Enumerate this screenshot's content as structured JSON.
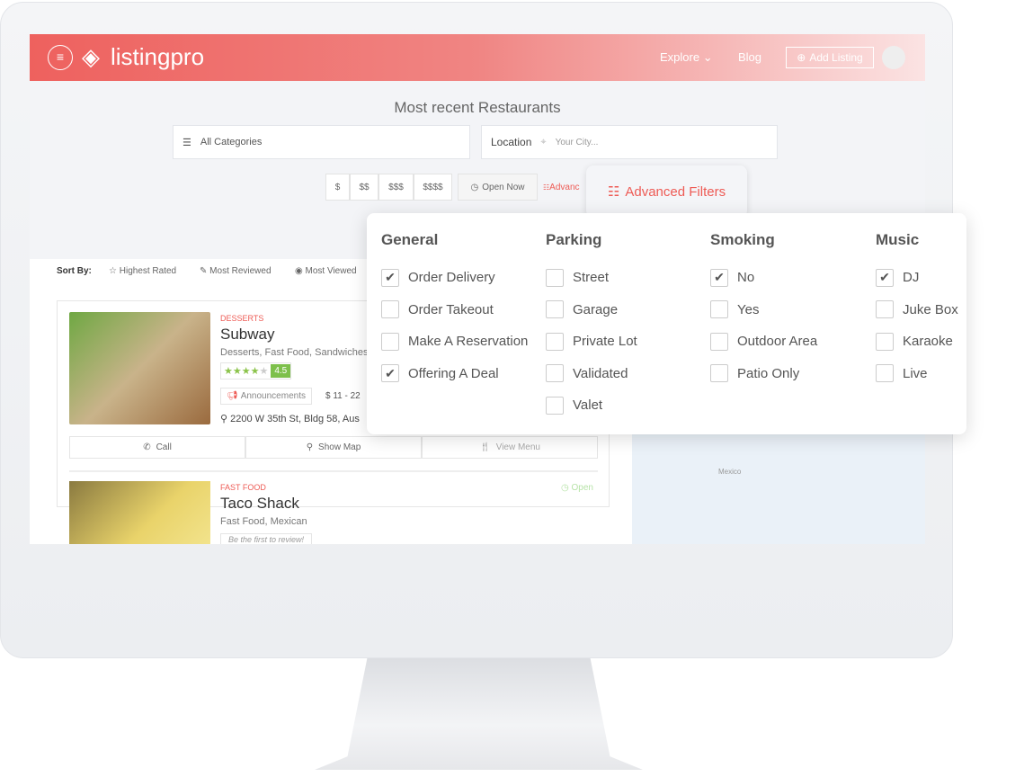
{
  "header": {
    "logo": "listingpro",
    "nav": [
      {
        "label": "Explore"
      },
      {
        "label": "Blog"
      }
    ],
    "add_listing": "Add Listing"
  },
  "hero": {
    "title": "Most recent Restaurants",
    "categories": "All Categories",
    "location_label": "Location",
    "location_placeholder": "Your City...",
    "prices": [
      "$",
      "$$",
      "$$$",
      "$$$$"
    ],
    "open_now": "Open Now",
    "advanced_partial": "Advanc"
  },
  "sort": {
    "label": "Sort By:",
    "options": [
      "Highest Rated",
      "Most Reviewed",
      "Most Viewed"
    ]
  },
  "listings": [
    {
      "category": "DESSERTS",
      "name": "Subway",
      "tags": "Desserts, Fast Food, Sandwiches",
      "rating": "4.5",
      "stars": 4.5,
      "announcement": "Announcements",
      "price": "$ 11 - 22",
      "address": "2200 W 35th St, Bldg 58, Aus",
      "actions": [
        "Call",
        "Show Map",
        "View Menu"
      ]
    },
    {
      "category": "FAST FOOD",
      "name": "Taco Shack",
      "tags": "Fast Food, Mexican",
      "status": "Open",
      "review": "Be the first to review!"
    }
  ],
  "map": {
    "label": "Mexico"
  },
  "advanced": {
    "tab_label": "Advanced Filters",
    "accent": "#ee5b55",
    "columns": [
      {
        "title": "General",
        "options": [
          {
            "label": "Order Delivery",
            "checked": true
          },
          {
            "label": "Order Takeout",
            "checked": false
          },
          {
            "label": "Make A Reservation",
            "checked": false
          },
          {
            "label": "Offering A Deal",
            "checked": true
          }
        ]
      },
      {
        "title": "Parking",
        "options": [
          {
            "label": "Street",
            "checked": false
          },
          {
            "label": "Garage",
            "checked": false
          },
          {
            "label": "Private Lot",
            "checked": false
          },
          {
            "label": "Validated",
            "checked": false
          },
          {
            "label": "Valet",
            "checked": false
          }
        ]
      },
      {
        "title": "Smoking",
        "options": [
          {
            "label": "No",
            "checked": true
          },
          {
            "label": "Yes",
            "checked": false
          },
          {
            "label": "Outdoor Area",
            "checked": false
          },
          {
            "label": "Patio Only",
            "checked": false
          }
        ]
      },
      {
        "title": "Music",
        "options": [
          {
            "label": "DJ",
            "checked": true
          },
          {
            "label": "Juke Box",
            "checked": false
          },
          {
            "label": "Karaoke",
            "checked": false
          },
          {
            "label": "Live",
            "checked": false
          }
        ]
      }
    ]
  }
}
